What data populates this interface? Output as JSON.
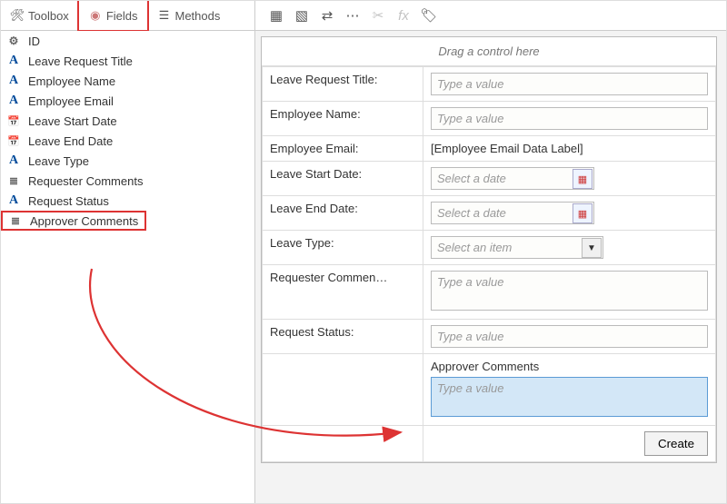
{
  "tabs": {
    "toolbox": "Toolbox",
    "fields": "Fields",
    "methods": "Methods"
  },
  "fields": [
    {
      "icon": "g",
      "glyph": "⚙",
      "label": "ID"
    },
    {
      "icon": "a",
      "glyph": "A",
      "label": "Leave Request Title"
    },
    {
      "icon": "a",
      "glyph": "A",
      "label": "Employee Name"
    },
    {
      "icon": "a",
      "glyph": "A",
      "label": "Employee Email"
    },
    {
      "icon": "d",
      "glyph": "📅",
      "label": "Leave Start Date"
    },
    {
      "icon": "d",
      "glyph": "📅",
      "label": "Leave End Date"
    },
    {
      "icon": "a",
      "glyph": "A",
      "label": "Leave Type"
    },
    {
      "icon": "g",
      "glyph": "≣",
      "label": "Requester Comments"
    },
    {
      "icon": "a",
      "glyph": "A",
      "label": "Request Status"
    },
    {
      "icon": "g",
      "glyph": "≣",
      "label": "Approver Comments"
    }
  ],
  "drop_hint": "Drag a control here",
  "form": {
    "rows": [
      {
        "label": "Leave Request Title:",
        "type": "text",
        "ph": "Type a value"
      },
      {
        "label": "Employee Name:",
        "type": "text",
        "ph": "Type a value"
      },
      {
        "label": "Employee Email:",
        "type": "label",
        "value": "[Employee Email Data Label]"
      },
      {
        "label": "Leave Start Date:",
        "type": "date",
        "ph": "Select a date"
      },
      {
        "label": "Leave End Date:",
        "type": "date",
        "ph": "Select a date"
      },
      {
        "label": "Leave Type:",
        "type": "select",
        "ph": "Select an item"
      },
      {
        "label": "Requester Commen…",
        "type": "textarea",
        "ph": "Type a value"
      },
      {
        "label": "Request Status:",
        "type": "text",
        "ph": "Type a value"
      }
    ],
    "approver_label": "Approver Comments",
    "approver_ph": "Type a value",
    "create": "Create"
  }
}
